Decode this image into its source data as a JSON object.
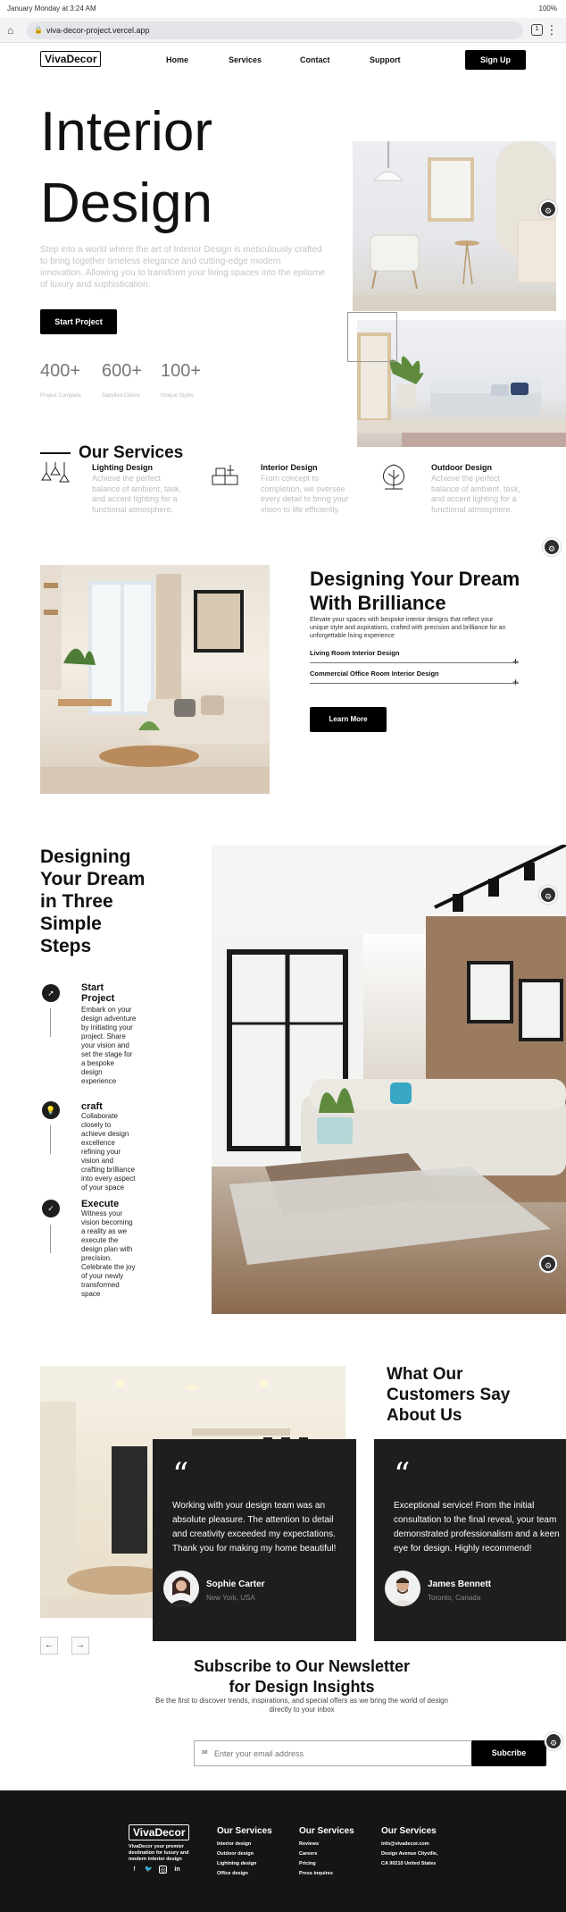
{
  "status": {
    "datetime": "January Monday at 3:24 AM",
    "battery": "100%"
  },
  "browser": {
    "url": "viva-decor-project.vercel.app"
  },
  "nav": {
    "logo": "VivaDecor",
    "links": [
      "Home",
      "Services",
      "Contact",
      "Support"
    ],
    "signup": "Sign Up"
  },
  "hero": {
    "title_line1": "Interior",
    "title_line2": "Design",
    "description": "Step into a world where the art of Interior Design is meticulously crafted to bring together timeless elegance and cutting-edge modern innovation. Allowing you to transform your living spaces into the epitome of luxury and sophistication.",
    "cta": "Start Project",
    "stats": [
      {
        "value": "400+",
        "label": "Project Complete"
      },
      {
        "value": "600+",
        "label": "Satisfied Clients"
      },
      {
        "value": "100+",
        "label": "Unique Styles"
      }
    ]
  },
  "services": {
    "title": "Our Services",
    "items": [
      {
        "icon": "pendant-lamp-icon",
        "name": "Lighting Design",
        "desc": "Achieve the perfect balance of ambient, task, and accent lighting for a functional atmosphere."
      },
      {
        "icon": "interior-furniture-icon",
        "name": "Interior Design",
        "desc": "From concept to completion, we oversee every detail to bring your vision to life efficiently."
      },
      {
        "icon": "outdoor-tree-icon",
        "name": "Outdoor Design",
        "desc": "Achieve the perfect balance of ambient, task, and accent lighting for a functional atmosphere."
      }
    ]
  },
  "brilliance": {
    "title": "Designing Your Dream With Brilliance",
    "description": "Elevate your spaces with bespoke interior designs that reflect your unique style and aspirations, crafted with precision and brilliance for an unforgettable living experience",
    "accordion": [
      "Living Room Interior Design",
      "Commercial Office Room Interior Design"
    ],
    "cta": "Learn More"
  },
  "steps": {
    "title": "Designing Your Dream in Three Simple Steps",
    "items": [
      {
        "icon": "rocket-icon",
        "title": "Start Project",
        "desc": "Embark on your design adventure by initiating your project. Share your vision and set the stage for a bespoke design experience"
      },
      {
        "icon": "lightbulb-icon",
        "title": "craft",
        "desc": "Collaborate closely to achieve design excellence refining your vision and crafting brilliance into every aspect of your space"
      },
      {
        "icon": "check-circle-icon",
        "title": "Execute",
        "desc": "Witness your vision becoming a reality as we execute the design plan with precision. Celebrate the joy of your newly transformed space"
      }
    ]
  },
  "testimonials": {
    "title": "What Our Customers Say About Us",
    "items": [
      {
        "quote": "Working with your design team was an absolute pleasure. The attention to detail and creativity exceeded my expectations. Thank you for making my home beautiful!",
        "name": "Sophie Carter",
        "location": "New York, USA"
      },
      {
        "quote": "Exceptional service! From the initial consultation to the final reveal, your team demonstrated professionalism and a keen eye for design. Highly recommend!",
        "name": "James Bennett",
        "location": "Toronto, Canada"
      }
    ]
  },
  "newsletter": {
    "title_line1": "Subscribe to Our Newsletter",
    "title_line2": "for Design Insights",
    "description": "Be the first to discover trends, inspirations, and special offers as we bring the world of design directly to your inbox",
    "placeholder": "Enter your email address",
    "button": "Subcribe"
  },
  "footer": {
    "logo": "VivaDecor",
    "tagline": "VivaDecor your premier destination for luxury and modern interior design",
    "columns": [
      {
        "title": "Our Services",
        "items": [
          "Interior design",
          "Outdoor design",
          "Lightning design",
          "Office design"
        ]
      },
      {
        "title": "Our Services",
        "items": [
          "Reviews",
          "Careers",
          "Pricing",
          "Press inquires"
        ]
      },
      {
        "title": "Our Services",
        "items": [
          "info@vivadecor.com",
          "Design Avenue Cityville,",
          "CA 90210 United States"
        ]
      }
    ]
  }
}
